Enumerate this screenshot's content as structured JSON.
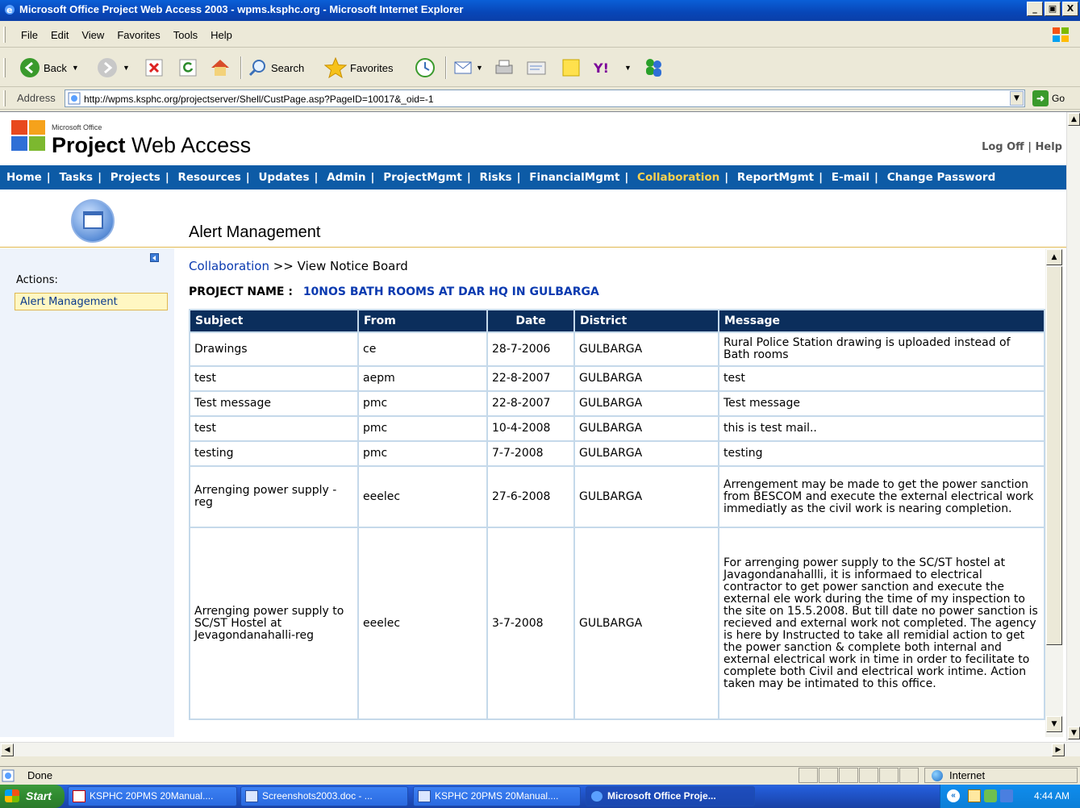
{
  "window": {
    "title": "Microsoft Office Project Web Access 2003 - wpms.ksphc.org - Microsoft Internet Explorer",
    "buttons": [
      "_",
      "Ԙ",
      "X"
    ]
  },
  "menubar": {
    "items": [
      "File",
      "Edit",
      "View",
      "Favorites",
      "Tools",
      "Help"
    ]
  },
  "toolbar": {
    "back_label": "Back",
    "search_label": "Search",
    "favorites_label": "Favorites"
  },
  "addressbar": {
    "label": "Address",
    "url": "http://wpms.ksphc.org/projectserver/Shell/CustPage.asp?PageID=10017&_oid=-1",
    "go_label": "Go"
  },
  "pwa": {
    "microsoft_office": "Microsoft Office",
    "product_bold": "Project",
    "product_rest": " Web Access",
    "log_off": "Log Off",
    "help": "Help",
    "nav": [
      "Home",
      "Tasks",
      "Projects",
      "Resources",
      "Updates",
      "Admin",
      "ProjectMgmt",
      "Risks",
      "FinancialMgmt",
      "Collaboration",
      "ReportMgmt",
      "E-mail",
      "Change Password"
    ],
    "active_nav": "Collaboration",
    "page_title": "Alert Management",
    "actions_label": "Actions:",
    "action_item": "Alert Management",
    "breadcrumb_link": "Collaboration",
    "breadcrumb_rest": " >> View Notice Board",
    "project_label": "PROJECT NAME :",
    "project_name": "10NOS BATH ROOMS AT DAR HQ IN GULBARGA"
  },
  "table": {
    "headers": [
      "Subject",
      "From",
      "Date",
      "District",
      "Message"
    ],
    "rows": [
      {
        "subject": "Drawings",
        "from": "ce",
        "date": "28-7-2006",
        "district": "GULBARGA",
        "message": "Rural Police Station drawing is uploaded instead of Bath rooms"
      },
      {
        "subject": "test",
        "from": "aepm",
        "date": "22-8-2007",
        "district": "GULBARGA",
        "message": "test"
      },
      {
        "subject": "Test message",
        "from": "pmc",
        "date": "22-8-2007",
        "district": "GULBARGA",
        "message": "Test message"
      },
      {
        "subject": "test",
        "from": "pmc",
        "date": "10-4-2008",
        "district": "GULBARGA",
        "message": "this is test mail.."
      },
      {
        "subject": "testing",
        "from": "pmc",
        "date": "7-7-2008",
        "district": "GULBARGA",
        "message": "testing"
      },
      {
        "subject": "Arrenging power supply - reg",
        "from": "eeelec",
        "date": "27-6-2008",
        "district": "GULBARGA",
        "message": "Arrengement may be made to get the power sanction from BESCOM and execute the external electrical work immediatly as the civil work is nearing completion."
      },
      {
        "subject": "Arrenging power supply to SC/ST Hostel at Jevagondanahalli-reg",
        "from": "eeelec",
        "date": "3-7-2008",
        "district": "GULBARGA",
        "message": "For arrenging power supply to the SC/ST hostel at Javagondanahallli, it is informaed to electrical contractor to get power sanction and execute the external ele work during the time of my inspection to the site on 15.5.2008. But till date no power sanction is recieved and external work not completed. The agency is here by Instructed to take all remidial action to get the power sanction & complete both internal and external electrical work in time in order to fecilitate to complete both Civil and electrical work intime. Action taken may be intimated to this office."
      }
    ]
  },
  "statusbar": {
    "text": "Done",
    "zone": "Internet"
  },
  "taskbar": {
    "start": "Start",
    "tasks": [
      {
        "label": "KSPHC 20PMS 20Manual....",
        "icon": "pdf-icon"
      },
      {
        "label": "Screenshots2003.doc - ...",
        "icon": "word-icon"
      },
      {
        "label": "KSPHC 20PMS 20Manual....",
        "icon": "word-icon"
      },
      {
        "label": "Microsoft Office Proje...",
        "icon": "ie-icon"
      }
    ],
    "clock": "4:44 AM",
    "chevron": "«"
  },
  "colors": {
    "nav_bg": "#0d5ba6",
    "nav_active": "#ffd24d",
    "table_header": "#0b2e5c",
    "link": "#0a3ab0"
  }
}
